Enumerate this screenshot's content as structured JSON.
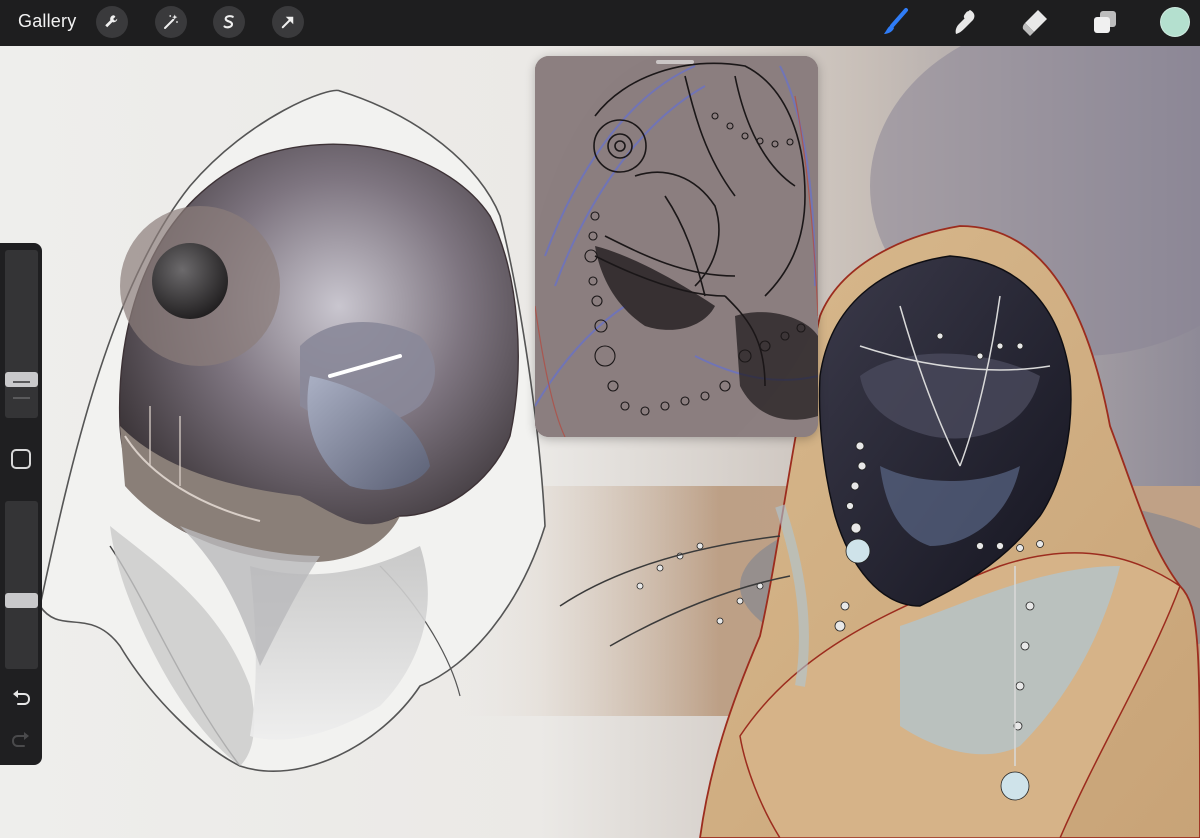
{
  "topbar": {
    "gallery_label": "Gallery",
    "left_tools": [
      "wrench-icon",
      "magic-wand-icon",
      "selection-s-icon",
      "transform-arrow-icon"
    ],
    "right_tools": [
      "brush-icon",
      "smudge-icon",
      "eraser-icon",
      "layers-icon"
    ],
    "active_tool": "brush-icon",
    "accent_color": "#2f7cf6",
    "current_color": "#b4e0cf"
  },
  "sidebar": {
    "brush_size_level": 0.2,
    "opacity_level": 0.4,
    "controls": [
      "brush-size-slider",
      "modify-button",
      "opacity-slider",
      "undo-icon",
      "redo-icon"
    ]
  },
  "reference_window": {
    "type": "reference-image",
    "background_color": "#8c7f80"
  }
}
